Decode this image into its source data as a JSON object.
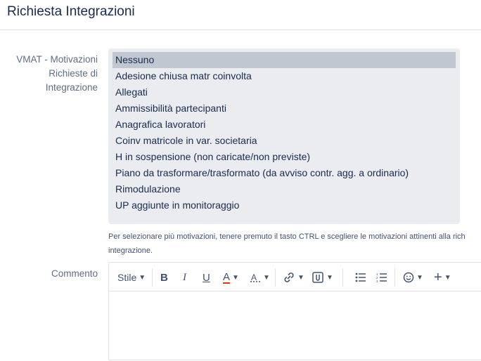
{
  "header": {
    "title": "Richiesta Integrazioni"
  },
  "fields": {
    "motivazioni": {
      "label": "VMAT - Motivazioni Richieste di Integrazione",
      "options": [
        "Nessuno",
        "Adesione chiusa matr coinvolta",
        "Allegati",
        "Ammissibilità partecipanti",
        "Anagrafica lavoratori",
        "Coinv matricole in var. societaria",
        "H in sospensione (non caricate/non previste)",
        "Piano da trasformare/trasformato (da avviso contr. agg. a ordinario)",
        "Rimodulazione",
        "UP aggiunte in monitoraggio"
      ],
      "selected": "Nessuno",
      "help_line1": "Per selezionare più motivazioni, tenere premuto il tasto CTRL e scegliere le motivazioni attinenti alla rich",
      "help_line2": "integrazione."
    },
    "commento": {
      "label": "Commento",
      "toolbar": {
        "style_label": "Stile",
        "bold": "B",
        "italic": "I",
        "underline": "U",
        "text_color": "A"
      }
    }
  },
  "colors": {
    "listbox_bg": "#ebecf0",
    "selected_bg": "#c1c7d0",
    "label": "#5e6c84"
  }
}
